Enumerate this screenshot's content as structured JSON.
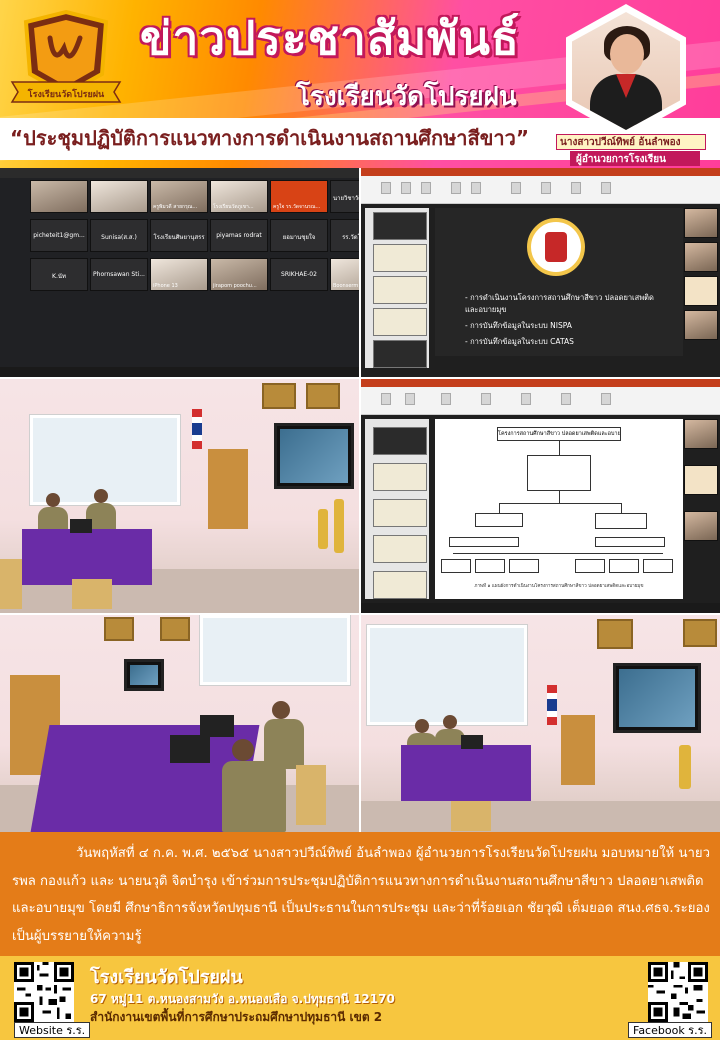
{
  "header": {
    "headline": "ข่าวประชาสัมพันธ์",
    "school": "โรงเรียนวัดโปรยฝน",
    "logo_ribbon": "โรงเรียนวัดโปรยฝน",
    "event_title": "“ประชุมปฏิบัติการแนวทางการดำเนินงานสถานศึกษาสีขาว”",
    "director_name": "นางสาวปวีณ์ทิพย์ อ้นลำพอง",
    "director_role": "ผู้อำนวยการโรงเรียน"
  },
  "photos": {
    "zoom_tiles": [
      "ครูพิมวดี สายกรุณ...",
      "โรงเรียนวัดภูเขา...",
      "ครูใจ รร.วัดจานรณ...",
      "นายวิชาวัฒน์ เกิด...",
      "picheteit1@gm...",
      "Sunisa(ส.ส.)",
      "โรงเรียนศิษยานุสรร",
      "piyamas rodrat",
      "ยอมานชุยใจ",
      "รร.วัดโคลพฯ",
      "K.นัท",
      "Phornsawan Sti...",
      "iPhone 13",
      "jirapom poochu...",
      "SRIKHAE-02",
      "Boonserm"
    ],
    "slide_bullets": [
      "- การดำเนินงานโครงการสถานศึกษาสีขาว ปลอดยาเสพติด",
      "  และอบายมุข",
      "- การบันทึกข้อมูลในระบบ NISPA",
      "- การบันทึกข้อมูลในระบบ CATAS"
    ],
    "org_title": "โครงการสถานศึกษาสีขาว ปลอดยาเสพติดและอบายมุข",
    "org_caption": "ภาพที่ ๑ แผนผังการดำเนินงานโครงการสถานศึกษาสีขาว ปลอดยาเสพติดและอบายมุข"
  },
  "body": {
    "paragraph": "วันพฤหัสที่ ๔ ก.ค. พ.ศ. ๒๕๖๕ นางสาวปวีณ์ทิพย์ อ้นลำพอง ผู้อำนวยการโรงเรียนวัดโปรยฝน มอบหมายให้ นายวรพล กองแก้ว และ นายนวุติ จิตบำรุง เข้าร่วมการประชุมปฏิบัติการแนวทางการดำเนินงานสถานศึกษาสีขาว ปลอดยาเสพติดและอบายมุข โดยมี ศึกษาธิการจังหวัดปทุมธานี เป็นประธานในการประชุม และว่าที่ร้อยเอก ชัยวุฒิ เต็มยอด สนง.ศธจ.ระยอง เป็นผู้บรรยายให้ความรู้"
  },
  "footer": {
    "school": "โรงเรียนวัดโปรยฝน",
    "address": "67 หมู่11 ต.หนองสามวัง อ.หนองเสือ จ.ปทุมธานี 12170",
    "office": "สำนักงานเขตพื้นที่การศึกษาประถมศึกษาปทุมธานี เขต 2",
    "website_label": "Website ร.ร.",
    "facebook_label": "Facebook ร.ร."
  },
  "colors": {
    "body_band": "#e47c18",
    "footer": "#f7c63f",
    "headline_outline": "#c2185b",
    "table_cloth": "#6a2ca7"
  }
}
